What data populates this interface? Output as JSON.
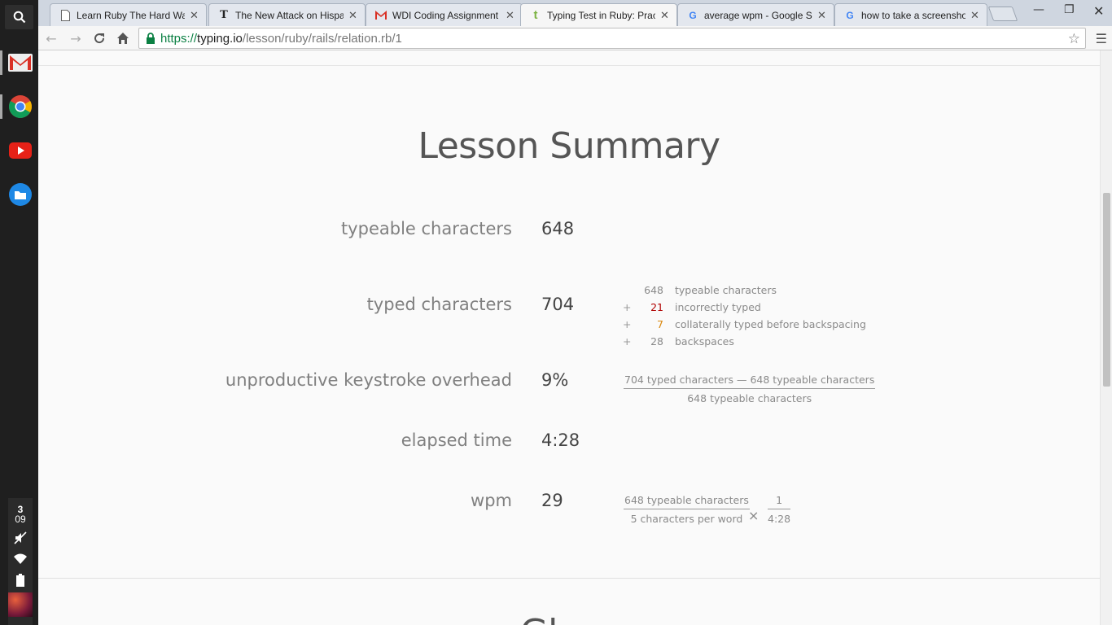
{
  "shelf": {
    "apps": [
      "gmail-icon",
      "chrome-icon",
      "youtube-icon",
      "files-icon"
    ],
    "clock_hour": "3",
    "clock_minute": "09"
  },
  "tabs": [
    {
      "title": "Learn Ruby The Hard Way",
      "favicon": "document-icon"
    },
    {
      "title": "The New Attack on Hispa",
      "favicon": "nyt-icon"
    },
    {
      "title": "WDI Coding Assignment &",
      "favicon": "gmail-icon"
    },
    {
      "title": "Typing Test in Ruby: Prac",
      "favicon": "typing-io-icon",
      "active": true
    },
    {
      "title": "average wpm - Google Se",
      "favicon": "google-icon"
    },
    {
      "title": "how to take a screenshot",
      "favicon": "google-icon"
    }
  ],
  "url": {
    "scheme": "https://",
    "host": "typing.io",
    "path": "/lesson/ruby/rails/relation.rb/1"
  },
  "summary": {
    "heading": "Lesson Summary",
    "rows": {
      "typeable": {
        "label": "typeable characters",
        "value": "648"
      },
      "typed": {
        "label": "typed characters",
        "value": "704"
      },
      "overhead": {
        "label": "unproductive keystroke overhead",
        "value": "9%"
      },
      "elapsed": {
        "label": "elapsed time",
        "value": "4:28"
      },
      "wpm": {
        "label": "wpm",
        "value": "29"
      }
    },
    "breakdown": [
      {
        "op": "",
        "num": "648",
        "text": "typeable characters"
      },
      {
        "op": "+",
        "num": "21",
        "text": "incorrectly typed"
      },
      {
        "op": "+",
        "num": "7",
        "text": "collaterally typed before backspacing"
      },
      {
        "op": "+",
        "num": "28",
        "text": "backspaces"
      }
    ],
    "overhead_formula": {
      "numerator": "704 typed characters — 648 typeable characters",
      "denominator": "648 typeable characters"
    },
    "wpm_formula": {
      "numerator": "648 typeable characters",
      "denominator": "5 characters per word",
      "times": "×",
      "numerator2": "1",
      "denominator2": "4:28"
    },
    "next_heading": "Gl"
  },
  "colors": {
    "accent_red": "#b00000",
    "accent_orange": "#d9860b",
    "url_green": "#0b8043"
  }
}
